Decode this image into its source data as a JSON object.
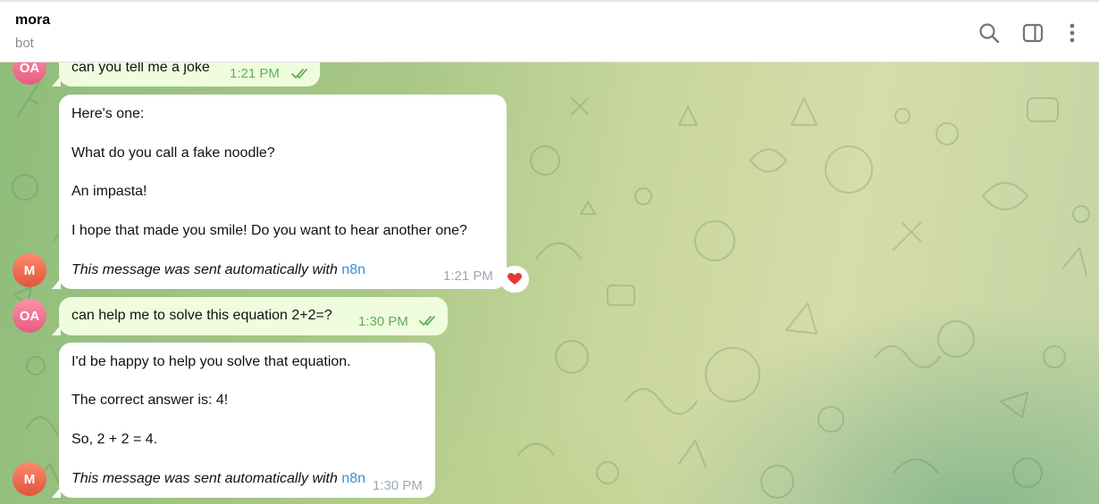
{
  "header": {
    "chat_name": "mora",
    "chat_status": "bot",
    "icons": [
      "search-icon",
      "sidebar-toggle-icon",
      "more-vertical-icon"
    ]
  },
  "colors": {
    "outgoing_bubble": "#effdde",
    "incoming_bubble": "#ffffff",
    "link": "#3a8fd6",
    "avatar_oa": "#e45d7f",
    "avatar_m": "#e0553d"
  },
  "messages": [
    {
      "direction": "outgoing",
      "avatar": "OA",
      "text": "can you tell me a joke",
      "time": "1:21 PM",
      "status": "read"
    },
    {
      "direction": "incoming",
      "avatar": "M",
      "lines": [
        "Here's one:",
        "What do you call a fake noodle?",
        "An impasta!",
        "I hope that made you smile! Do you want to hear another one?"
      ],
      "footer": "This message was sent automatically with",
      "footer_link": "n8n",
      "time": "1:21 PM",
      "reaction": "red-heart"
    },
    {
      "direction": "outgoing",
      "avatar": "OA",
      "text": "can help me to solve this equation 2+2=?",
      "time": "1:30 PM",
      "status": "read"
    },
    {
      "direction": "incoming",
      "avatar": "M",
      "lines": [
        "I'd be happy to help you solve that equation.",
        "The correct answer is: 4!",
        "So, 2 + 2 = 4."
      ],
      "footer": "This message was sent automatically with",
      "footer_link": "n8n",
      "time": "1:30 PM"
    }
  ]
}
